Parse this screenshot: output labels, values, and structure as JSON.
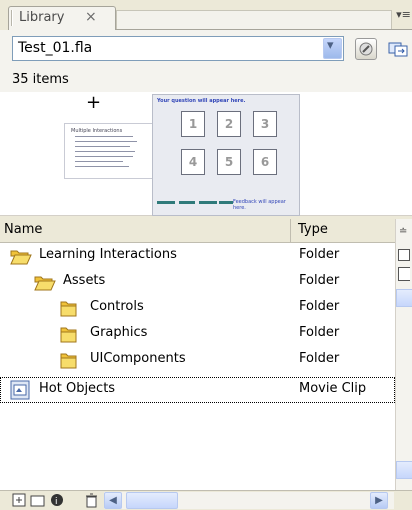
{
  "panel": {
    "tab_label": "Library",
    "tab_close": "×",
    "menu_glyph": "▾≡"
  },
  "toolbar": {
    "file_value": "Test_01.fla",
    "dropdown_glyph": "▾"
  },
  "status": {
    "count": "35 items"
  },
  "preview": {
    "crosshair": "+",
    "thumb_a_title": "Multiple Interactions",
    "thumb_b_title": "Your question will appear here.",
    "thumb_b_footer": "Feedback will appear here.",
    "thumb_b_cells": [
      "1",
      "2",
      "3",
      "4",
      "5",
      "6"
    ]
  },
  "columns": {
    "name": "Name",
    "type": "Type"
  },
  "items": [
    {
      "name": "Learning Interactions",
      "type": "Folder",
      "icon": "folder-open-icon"
    },
    {
      "name": "Assets",
      "type": "Folder",
      "icon": "folder-open-icon"
    },
    {
      "name": "Controls",
      "type": "Folder",
      "icon": "folder-closed-icon"
    },
    {
      "name": "Graphics",
      "type": "Folder",
      "icon": "folder-closed-icon"
    },
    {
      "name": "UIComponents",
      "type": "Folder",
      "icon": "folder-closed-icon"
    },
    {
      "name": "Hot Objects",
      "type": "Movie Clip",
      "icon": "movie-clip-icon"
    }
  ],
  "colors": {
    "panel_bg": "#ece9d8",
    "folder_yellow": "#f5cc46",
    "scroll_blue": "#c6d6fb",
    "selection_border": "#000000"
  }
}
